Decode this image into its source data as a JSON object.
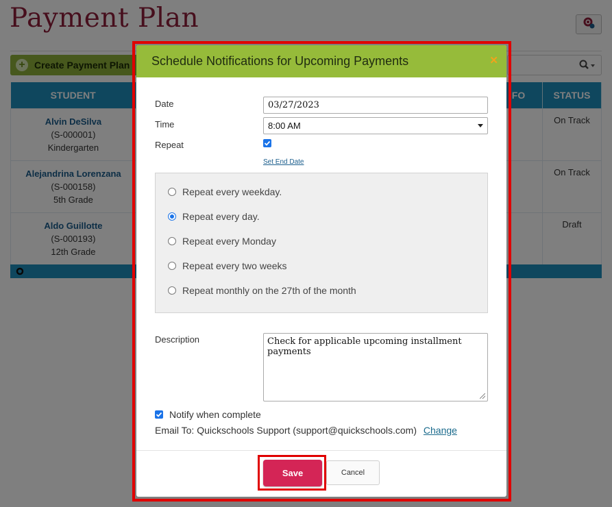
{
  "page": {
    "title": "Payment Plan",
    "create_button_label": "Create Payment Plan",
    "table_headers": {
      "student": "STUDENT",
      "info_partial": "IFO",
      "status": "STATUS"
    },
    "rows": [
      {
        "name": "Alvin DeSilva",
        "id": "(S-000001)",
        "grade": "Kindergarten",
        "status": "On Track"
      },
      {
        "name": "Alejandrina Lorenzana",
        "id": "(S-000158)",
        "grade": "5th Grade",
        "status": "On Track"
      },
      {
        "name": "Aldo Guillotte",
        "id": "(S-000193)",
        "grade": "12th Grade",
        "status": "Draft"
      }
    ],
    "icons": {
      "settings": "gear-icon",
      "search": "search-icon",
      "footer": "gear-icon"
    }
  },
  "dialog": {
    "title": "Schedule Notifications for Upcoming Payments",
    "date_label": "Date",
    "date_value": "03/27/2023",
    "time_label": "Time",
    "time_value": "8:00 AM",
    "repeat_label": "Repeat",
    "repeat_checked": true,
    "set_end_date_link": "Set End Date",
    "repeat_options": [
      {
        "label": "Repeat every weekday.",
        "selected": false
      },
      {
        "label": "Repeat every day.",
        "selected": true
      },
      {
        "label": "Repeat every Monday",
        "selected": false
      },
      {
        "label": "Repeat every two weeks",
        "selected": false
      },
      {
        "label": "Repeat monthly on the 27th of the month",
        "selected": false
      }
    ],
    "description_label": "Description",
    "description_value": "Check for applicable upcoming installment payments",
    "notify_label": "Notify when complete",
    "notify_checked": true,
    "email_to": "Email To: Quickschools Support (support@quickschools.com)",
    "change_link": "Change",
    "save_label": "Save",
    "cancel_label": "Cancel"
  },
  "colors": {
    "header_green": "#96bb3a",
    "title_red": "#8e1f3b",
    "table_blue": "#1e8fbd",
    "save_pink": "#d42556",
    "highlight_red": "#e00000"
  }
}
